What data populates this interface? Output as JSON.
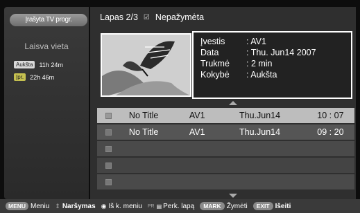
{
  "sidebar": {
    "title": "Įrašyta TV progr.",
    "free_space_label": "Laisva vieta",
    "stats": [
      {
        "badge": "Aukšta",
        "value": "11h 24m"
      },
      {
        "badge": "Įpr.",
        "value": "22h 46m"
      }
    ]
  },
  "header": {
    "page": "Lapas 2/3",
    "mark_icon": "☑",
    "mark_label": "Nepažymėta"
  },
  "info": {
    "input": {
      "key": "Įvestis",
      "value": ": AV1"
    },
    "date": {
      "key": "Data",
      "value": ": Thu. Jun14 2007"
    },
    "duration": {
      "key": "Trukmė",
      "value": ": 2 min"
    },
    "quality": {
      "key": "Kokybė",
      "value": ": Aukšta"
    }
  },
  "recordings": [
    {
      "title": "No Title",
      "input": "AV1",
      "date": "Thu.Jun14",
      "time": "10 : 07"
    },
    {
      "title": "No Title",
      "input": "AV1",
      "date": "Thu.Jun14",
      "time": "09 : 20"
    }
  ],
  "bottom": {
    "menu_key": "MENU",
    "menu_label": "Meniu",
    "nav_label": "Naršymas",
    "exit_menu_label": "Iš k. meniu",
    "pr_key": "PR",
    "page_label": "Perk. lapą",
    "mark_key": "MARK",
    "mark_label": "Žymėti",
    "exit_key": "EXIT",
    "exit_label": "Išeiti"
  }
}
